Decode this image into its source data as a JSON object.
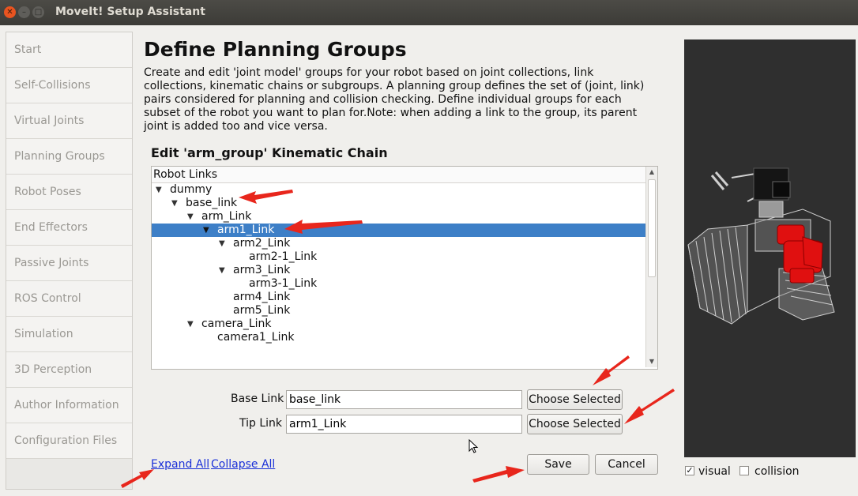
{
  "window": {
    "title": "MoveIt! Setup Assistant"
  },
  "sidebar": {
    "items": [
      {
        "label": "Start"
      },
      {
        "label": "Self-Collisions"
      },
      {
        "label": "Virtual Joints"
      },
      {
        "label": "Planning Groups"
      },
      {
        "label": "Robot Poses"
      },
      {
        "label": "End Effectors"
      },
      {
        "label": "Passive Joints"
      },
      {
        "label": "ROS Control"
      },
      {
        "label": "Simulation"
      },
      {
        "label": "3D Perception"
      },
      {
        "label": "Author Information"
      },
      {
        "label": "Configuration Files"
      }
    ]
  },
  "main": {
    "title": "Define Planning Groups",
    "description": "Create and edit 'joint model' groups for your robot based on joint collections, link collections, kinematic chains or subgroups. A planning group defines the set of (joint, link) pairs considered for planning and collision checking. Define individual groups for each subset of the robot you want to plan for.Note: when adding a link to the group, its parent joint is added too and vice versa.",
    "subtitle": "Edit 'arm_group' Kinematic Chain"
  },
  "tree": {
    "header": "Robot Links",
    "rows": [
      {
        "label": "dummy"
      },
      {
        "label": "base_link"
      },
      {
        "label": "arm_Link"
      },
      {
        "label": "arm1_Link"
      },
      {
        "label": "arm2_Link"
      },
      {
        "label": "arm2-1_Link"
      },
      {
        "label": "arm3_Link"
      },
      {
        "label": "arm3-1_Link"
      },
      {
        "label": "arm4_Link"
      },
      {
        "label": "arm5_Link"
      },
      {
        "label": "camera_Link"
      },
      {
        "label": "camera1_Link"
      }
    ]
  },
  "form": {
    "base_label": "Base Link",
    "base_value": "base_link",
    "tip_label": "Tip Link",
    "tip_value": "arm1_Link",
    "choose_label": "Choose Selected"
  },
  "actions": {
    "expand_all": "Expand All",
    "collapse_all": "Collapse All",
    "save": "Save",
    "cancel": "Cancel"
  },
  "viewer": {
    "visual_label": "visual",
    "visual_checked": true,
    "collision_label": "collision",
    "collision_checked": false
  },
  "colors": {
    "selection": "#3d7fc7",
    "annotation_arrow": "#e8261c",
    "highlight_part": "#e01010"
  }
}
